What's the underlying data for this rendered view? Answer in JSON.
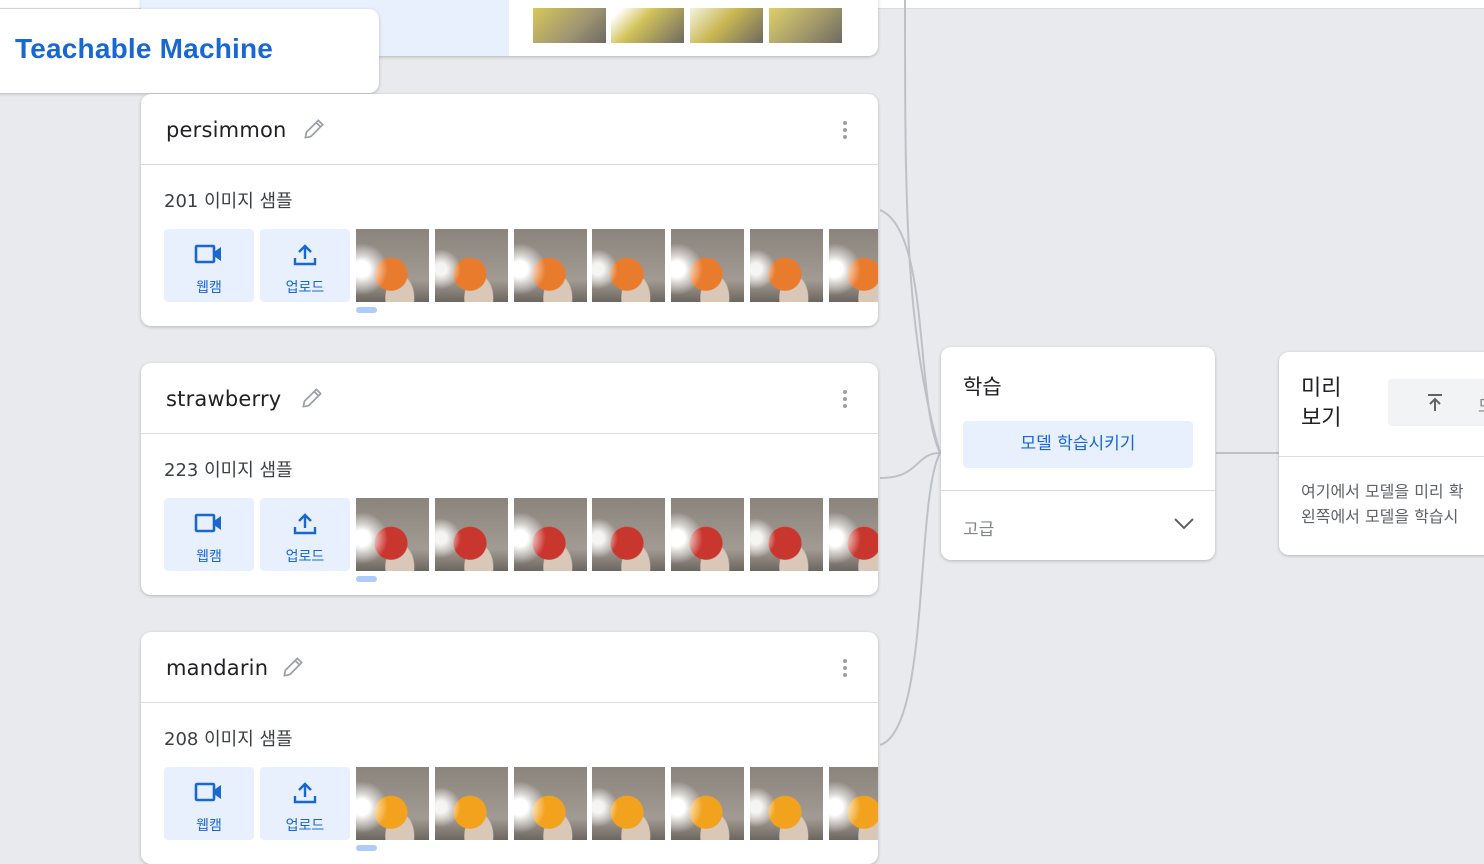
{
  "app": {
    "title": "Teachable Machine"
  },
  "classes": [
    {
      "name": "persimmon",
      "count_label": "201 이미지 샘플",
      "webcam_label": "웹캠",
      "upload_label": "업로드",
      "thumb_color": "#e97b2c"
    },
    {
      "name": "strawberry",
      "count_label": "223 이미지 샘플",
      "webcam_label": "웹캠",
      "upload_label": "업로드",
      "thumb_color": "#c9362e"
    },
    {
      "name": "mandarin",
      "count_label": "208 이미지 샘플",
      "webcam_label": "웹캠",
      "upload_label": "업로드",
      "thumb_color": "#f2a21c"
    }
  ],
  "training": {
    "title": "학습",
    "train_button": "모델 학습시키기",
    "advanced_label": "고급"
  },
  "preview": {
    "title_line1": "미리",
    "title_line2": "보기",
    "export_button_partial": "모",
    "description_line1": "여기에서 모델을 미리 확",
    "description_line2": "왼쪽에서 모델을 학습시"
  },
  "colors": {
    "accent": "#1967d2",
    "accent_bg": "#e8f0fe",
    "canvas_bg": "#e8eaed"
  }
}
